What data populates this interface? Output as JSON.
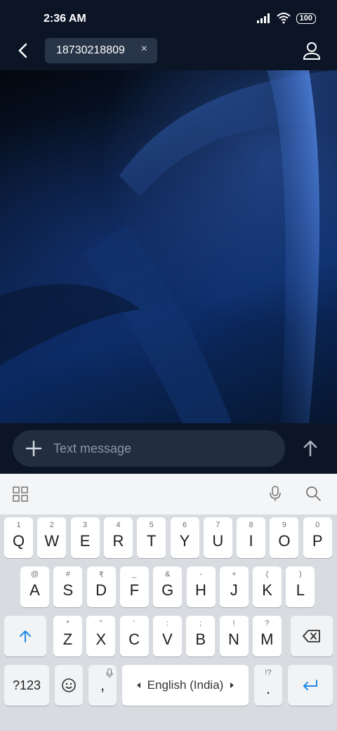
{
  "status": {
    "time": "2:36 AM",
    "battery": "100"
  },
  "header": {
    "recipient": "18730218809",
    "clear_symbol": "×"
  },
  "composer": {
    "placeholder": "Text message"
  },
  "keyboard": {
    "row1": [
      {
        "hint": "1",
        "label": "Q"
      },
      {
        "hint": "2",
        "label": "W"
      },
      {
        "hint": "3",
        "label": "E"
      },
      {
        "hint": "4",
        "label": "R"
      },
      {
        "hint": "5",
        "label": "T"
      },
      {
        "hint": "6",
        "label": "Y"
      },
      {
        "hint": "7",
        "label": "U"
      },
      {
        "hint": "8",
        "label": "I"
      },
      {
        "hint": "9",
        "label": "O"
      },
      {
        "hint": "0",
        "label": "P"
      }
    ],
    "row2": [
      {
        "hint": "@",
        "label": "A"
      },
      {
        "hint": "#",
        "label": "S"
      },
      {
        "hint": "₹",
        "label": "D"
      },
      {
        "hint": "_",
        "label": "F"
      },
      {
        "hint": "&",
        "label": "G"
      },
      {
        "hint": "-",
        "label": "H"
      },
      {
        "hint": "+",
        "label": "J"
      },
      {
        "hint": "(",
        "label": "K"
      },
      {
        "hint": ")",
        "label": "L"
      }
    ],
    "row3": [
      {
        "hint": "*",
        "label": "Z"
      },
      {
        "hint": "\"",
        "label": "X"
      },
      {
        "hint": "'",
        "label": "C"
      },
      {
        "hint": ":",
        "label": "V"
      },
      {
        "hint": ";",
        "label": "B"
      },
      {
        "hint": "!",
        "label": "N"
      },
      {
        "hint": "?",
        "label": "M"
      }
    ],
    "symbols_key": "?123",
    "comma_key": ",",
    "space_label": "English (India)",
    "period_hint": "!?",
    "period_key": "."
  },
  "colors": {
    "accent": "#1e88e5"
  }
}
